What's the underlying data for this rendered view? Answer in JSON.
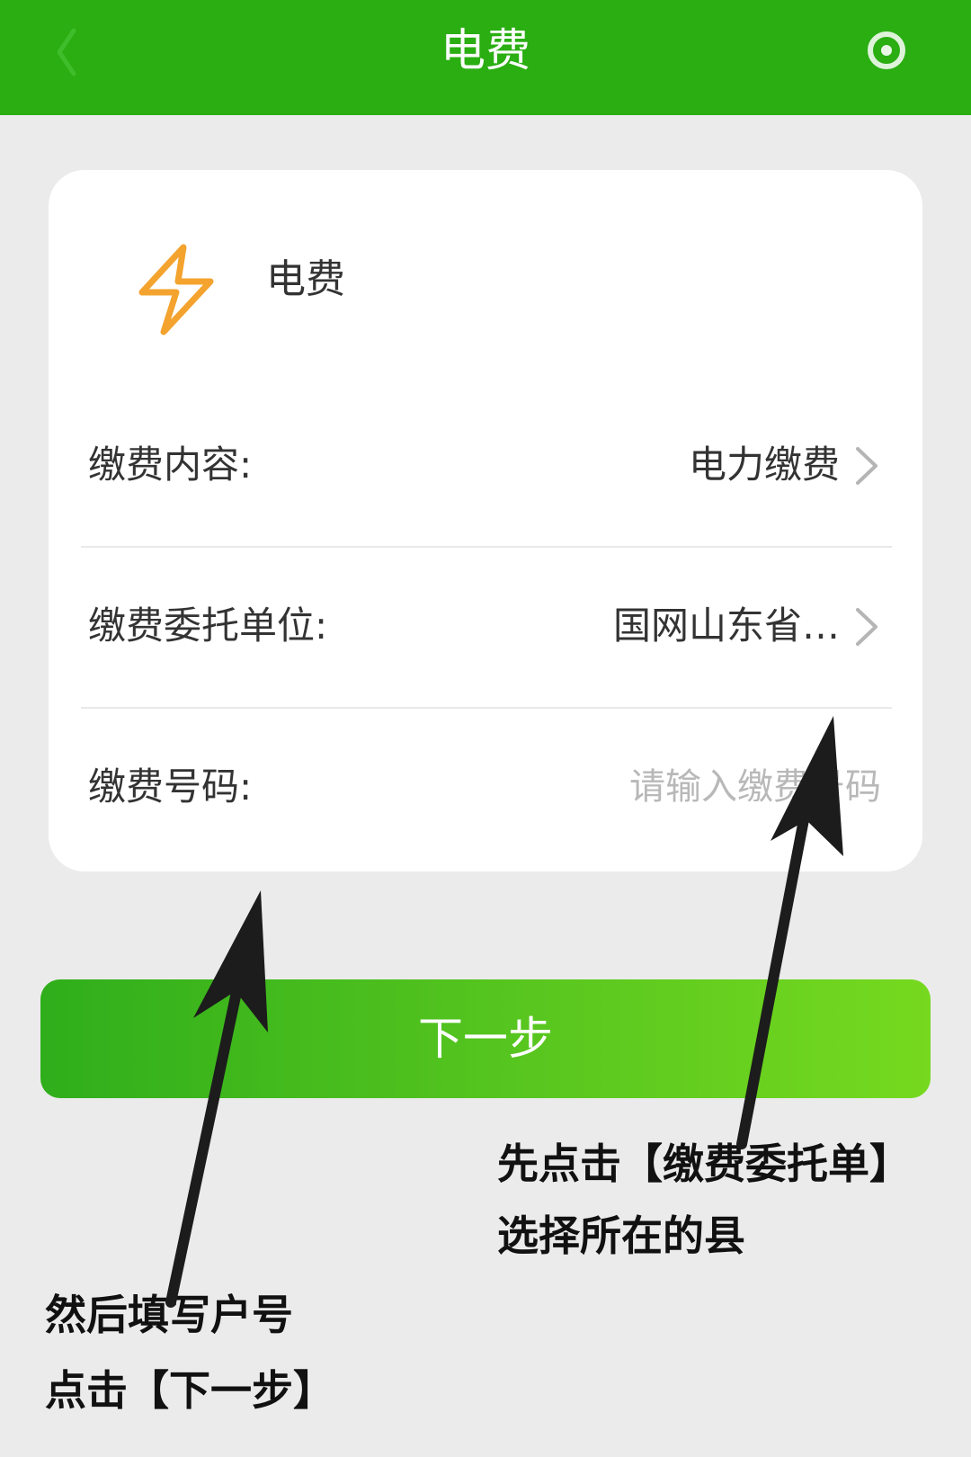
{
  "header": {
    "title": "电费",
    "back_icon": "back-icon",
    "more_icon": "more-icon",
    "bar_color": "#2aae12"
  },
  "card": {
    "icon": "lightning-bolt-icon",
    "icon_color": "#f3a32e",
    "title": "电费",
    "rows": [
      {
        "label": "缴费内容:",
        "value": "电力缴费"
      },
      {
        "label": "缴费委托单位:",
        "value": "国网山东省…"
      },
      {
        "label": "缴费号码:",
        "placeholder": "请输入缴费号码"
      }
    ]
  },
  "next_button": {
    "label": "下一步"
  },
  "annotations": {
    "right_note": [
      "先点击【缴费委托单】",
      "选择所在的县"
    ],
    "left_note": [
      "然后填写户号",
      "点击【下一步】"
    ]
  }
}
